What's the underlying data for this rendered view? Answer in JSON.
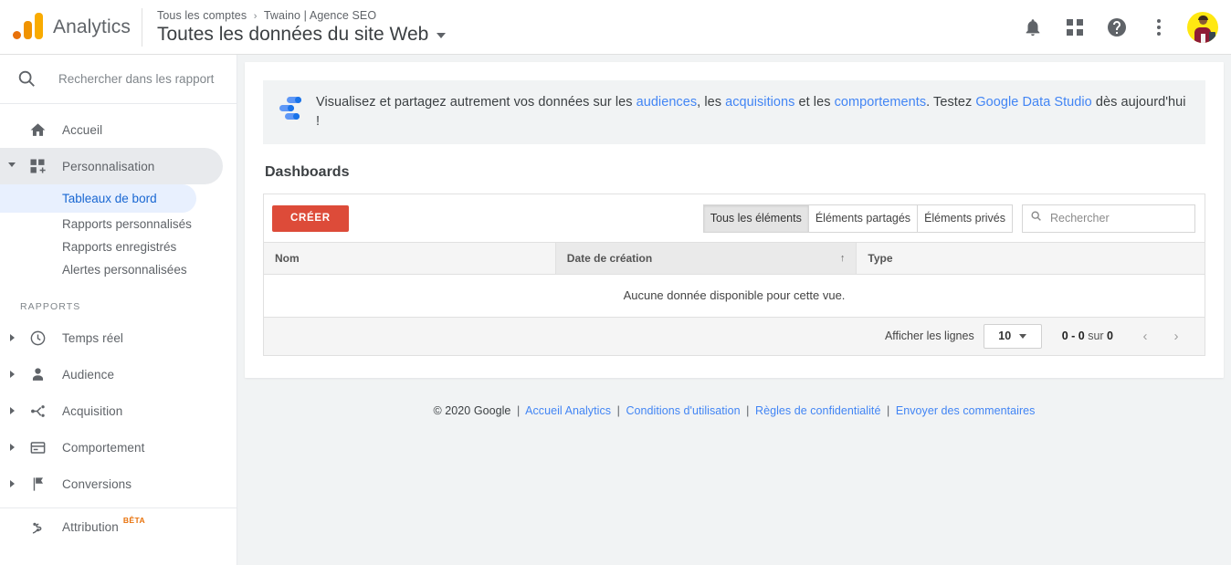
{
  "header": {
    "brand": "Analytics",
    "breadcrumb": {
      "account": "Tous les comptes",
      "separator": "›",
      "property": "Twaino | Agence SEO"
    },
    "view_title": "Toutes les données du site Web",
    "icons": {
      "notifications": "bell-icon",
      "apps": "apps-grid-icon",
      "help": "help-circle-icon",
      "more": "more-vert-icon",
      "avatar": "user-avatar"
    }
  },
  "sidebar": {
    "search_placeholder": "Rechercher dans les rapport",
    "search_value": "",
    "home": {
      "label": "Accueil",
      "icon": "home-icon"
    },
    "customization": {
      "label": "Personnalisation",
      "icon": "customization-icon",
      "expanded": true,
      "children": [
        {
          "label": "Tableaux de bord",
          "selected": true
        },
        {
          "label": "Rapports personnalisés",
          "selected": false
        },
        {
          "label": "Rapports enregistrés",
          "selected": false
        },
        {
          "label": "Alertes personnalisées",
          "selected": false
        }
      ]
    },
    "section_label": "RAPPORTS",
    "reports": [
      {
        "label": "Temps réel",
        "icon": "clock-icon",
        "badge": ""
      },
      {
        "label": "Audience",
        "icon": "person-icon",
        "badge": ""
      },
      {
        "label": "Acquisition",
        "icon": "acquisition-icon",
        "badge": ""
      },
      {
        "label": "Comportement",
        "icon": "behavior-icon",
        "badge": ""
      },
      {
        "label": "Conversions",
        "icon": "flag-icon",
        "badge": ""
      }
    ],
    "attribution": {
      "label": "Attribution",
      "badge": "BÊTA",
      "icon": "attribution-icon"
    }
  },
  "promo": {
    "icon": "data-studio-icon",
    "part1": "Visualisez et partagez autrement vos données sur les ",
    "link1": "audiences",
    "part2": ", les ",
    "link2": "acquisitions",
    "part3": " et les ",
    "link3": "comportements",
    "part4": ". Testez ",
    "link4": "Google Data Studio",
    "part5": " dès aujourd'hui !"
  },
  "main": {
    "page_title": "Dashboards",
    "create_button": "CRÉER",
    "segments": [
      {
        "label": "Tous les éléments",
        "selected": true
      },
      {
        "label": "Éléments partagés",
        "selected": false
      },
      {
        "label": "Éléments privés",
        "selected": false
      }
    ],
    "search_placeholder": "Rechercher",
    "search_value": "",
    "table": {
      "columns": [
        {
          "label": "Nom",
          "sorted": false,
          "sort_dir": ""
        },
        {
          "label": "Date de création",
          "sorted": true,
          "sort_dir": "↑"
        },
        {
          "label": "Type",
          "sorted": false,
          "sort_dir": ""
        }
      ],
      "rows": [],
      "empty_message": "Aucune donnée disponible pour cette vue."
    },
    "pagination": {
      "rows_label": "Afficher les lignes",
      "rows_per_page": "10",
      "range": "0 - 0 sur 0",
      "range_start": "0 - 0",
      "range_mid": " sur ",
      "range_end": "0",
      "prev": "‹",
      "next": "›"
    }
  },
  "footer": {
    "copyright": "© 2020 Google",
    "links": [
      "Accueil Analytics",
      "Conditions d'utilisation",
      "Règles de confidentialité",
      "Envoyer des commentaires"
    ],
    "separator": "|"
  },
  "colors": {
    "accent_blue": "#4285f4",
    "selected_blue": "#1967d2",
    "selected_bg": "#e8f0fe",
    "create_red": "#dd4b39",
    "beta_orange": "#E8710A",
    "avatar_yellow": "#FFE812"
  }
}
